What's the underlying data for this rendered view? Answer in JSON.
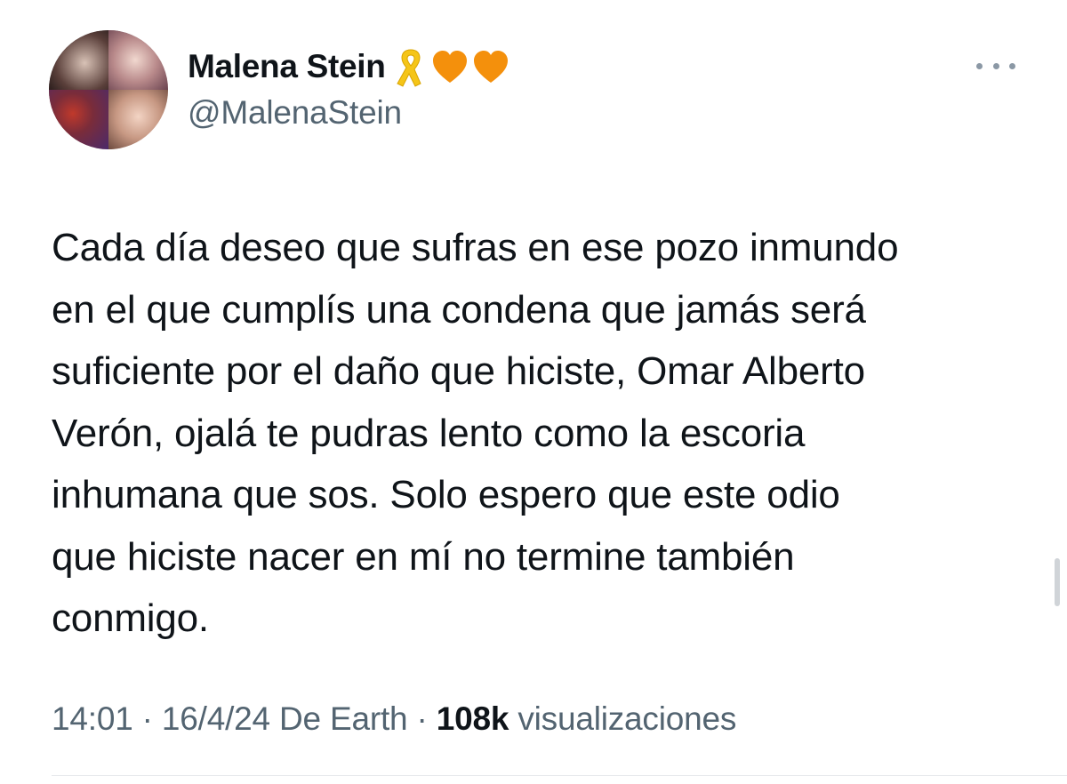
{
  "author": {
    "display_name": "Malena Stein",
    "handle": "@MalenaStein",
    "name_emojis": [
      "yellow-ribbon-icon",
      "orange-heart-icon",
      "orange-heart-icon"
    ]
  },
  "tweet": {
    "text": "Cada día deseo que sufras en ese pozo inmundo\nen el que cumplís una condena que jamás será\nsuficiente por el daño que hiciste, Omar Alberto\nVerón, ojalá te pudras lento como la escoria\ninhumana que sos. Solo espero que este odio\nque hiciste nacer en mí no termine también\nconmigo."
  },
  "meta": {
    "time": "14:01",
    "separator": " · ",
    "date": "16/4/24",
    "location_prefix": " De ",
    "location": "Earth",
    "views_count": "108k",
    "views_label": "visualizaciones"
  },
  "colors": {
    "text_primary": "#0f1419",
    "text_secondary": "#536471",
    "ribbon": "#f5c518",
    "heart": "#f4900c"
  }
}
